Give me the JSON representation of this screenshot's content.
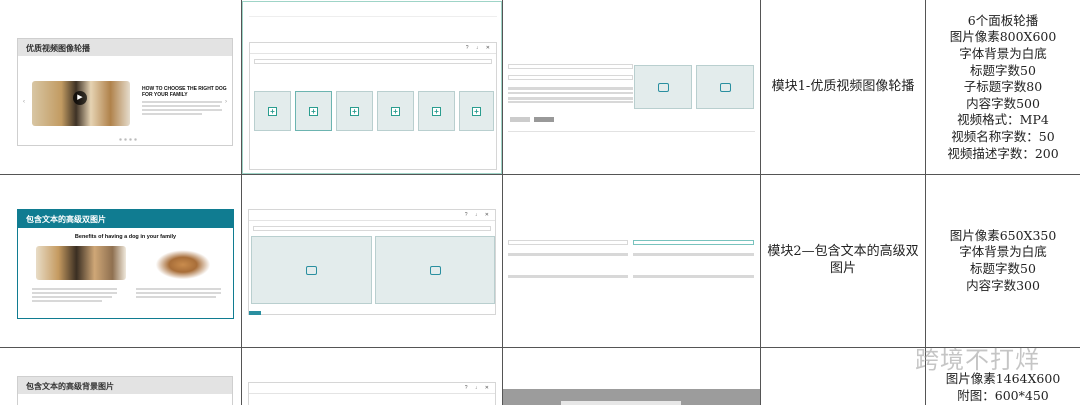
{
  "rows": [
    {
      "preview_title": "优质视频图像轮播",
      "preview_heading": "HOW TO CHOOSE THE RIGHT DOG FOR YOUR FAMILY",
      "module_name": "模块1-优质视频图像轮播",
      "specs": [
        "6个面板轮播",
        "图片像素800X600",
        "字体背景为白底",
        "标题字数50",
        "子标题字数80",
        "内容字数500",
        "视频格式：MP4",
        "视频名称字数：50",
        "视频描述字数：200"
      ]
    },
    {
      "preview_title": "包含文本的高级双图片",
      "preview_heading": "Benefits of having a dog in your family",
      "module_name": "模块2—包含文本的高级双图片",
      "specs": [
        "图片像素650X350",
        "字体背景为白底",
        "标题字数50",
        "内容字数300"
      ]
    },
    {
      "preview_title": "包含文本的高级背景图片",
      "specs": [
        "图片像素1464X600",
        "附图：600*450"
      ]
    }
  ],
  "watermark": "跨境不打烊",
  "colors": {
    "teal": "#107c91",
    "grid": "#555555",
    "placeholder": "#e3ecec"
  }
}
